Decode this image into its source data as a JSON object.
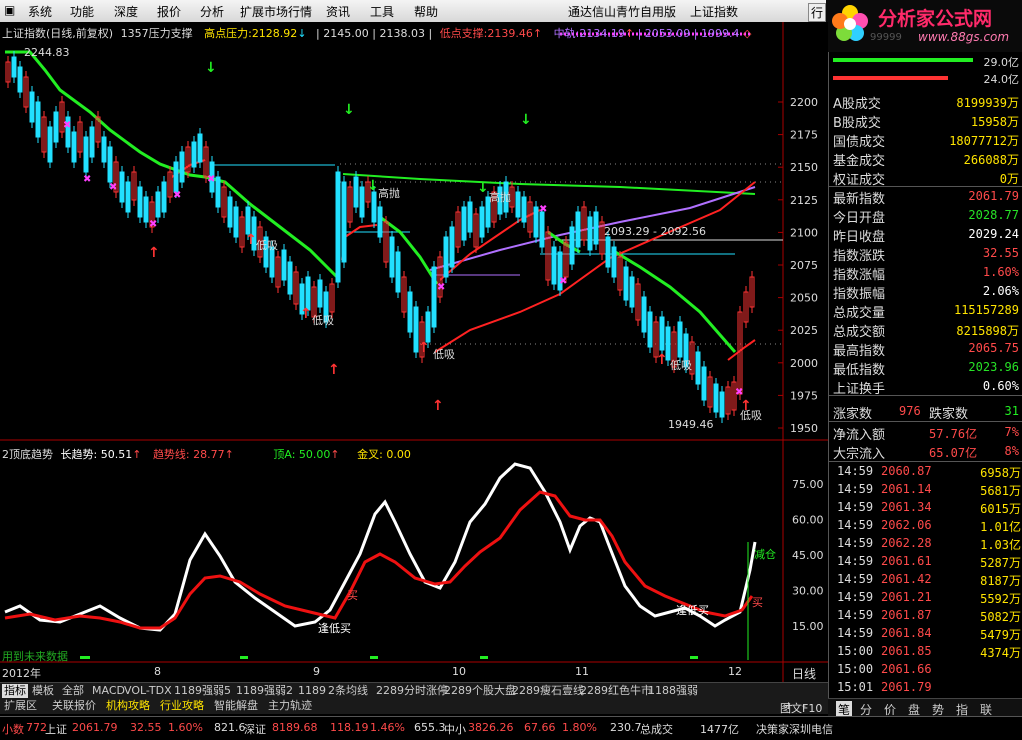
{
  "menu": {
    "items": [
      "系统",
      "功能",
      "深度",
      "报价",
      "分析",
      "扩展市场行情",
      "资讯",
      "工具",
      "帮助"
    ],
    "window_title": "通达信山青竹自用版",
    "index_title": "上证指数",
    "right_btn": "行"
  },
  "logo": {
    "brand": "分析家公式网",
    "url": "www.88gs.com",
    "sub_digits": "99999"
  },
  "main_header": {
    "name": "上证指数(日线,前复权)",
    "indicator": "1357压力支撑",
    "high_label": "高点压力:",
    "high_value": "2128.92",
    "v2": "2145.00",
    "v3": "2138.03",
    "low_label": "低点支撑:",
    "low_value": "2139.46",
    "mid_label": "中轨:",
    "mid_value": "2134.19",
    "v4": "2053.09",
    "v5": "1999.4"
  },
  "price_axis": [
    "2200",
    "2175",
    "2150",
    "2125",
    "2100",
    "2075",
    "2050",
    "2025",
    "2000",
    "1975",
    "1950"
  ],
  "annotations": {
    "top_price": "2244.83",
    "low_price": "1949.46",
    "range_label": "2093.29 - 2092.56",
    "high_throw": "高抛",
    "low_buy": "低吸",
    "sub_label": "低吸"
  },
  "sub_header": {
    "name": "2顶底趋势",
    "long_label": "长趋势:",
    "long_value": "50.51",
    "trend_label": "趋势线:",
    "trend_value": "28.77",
    "top_label": "顶A:",
    "top_value": "50.00",
    "gold_label": "金叉:",
    "gold_value": "0.00"
  },
  "sub_axis": [
    "75.00",
    "60.00",
    "45.00",
    "30.00",
    "15.00"
  ],
  "sub_annotations": {
    "buy_low": "逢低买",
    "reduce": "减仓",
    "buy": "买",
    "future": "用到未来数据"
  },
  "x_axis": {
    "labels": [
      "2012年",
      "8",
      "9",
      "10",
      "11",
      "12"
    ],
    "period": "日线"
  },
  "tabs_row1": [
    "指标",
    "模板",
    "全部",
    "MACD",
    "VOL-TDX",
    "1189强弱5",
    "1189强弱2",
    "1189",
    "2条均线",
    "2289分时涨停",
    "2289个股大盘",
    "2289瘦石壹线",
    "2289红色牛市",
    "1188强弱"
  ],
  "tabs_row1_active": "指标",
  "tabs_row2": [
    "扩展区",
    "关联报价",
    "机构攻略",
    "行业攻略",
    "智能解盘",
    "主力轨迹"
  ],
  "chart_buttons": {
    "plus": "+",
    "minus": "-",
    "page": "图文F10"
  },
  "side": {
    "bar1_value": "29.0亿",
    "bar2_value": "24.0亿",
    "rows": [
      {
        "label": "A股成交",
        "value": "8199939万",
        "color": "yellow"
      },
      {
        "label": "B股成交",
        "value": "15958万",
        "color": "yellow"
      },
      {
        "label": "国债成交",
        "value": "18077712万",
        "color": "yellow"
      },
      {
        "label": "基金成交",
        "value": "266088万",
        "color": "yellow"
      },
      {
        "label": "权证成交",
        "value": "0万",
        "color": "yellow"
      },
      {
        "label": "最新指数",
        "value": "2061.79",
        "color": "red"
      },
      {
        "label": "今日开盘",
        "value": "2028.77",
        "color": "green"
      },
      {
        "label": "昨日收盘",
        "value": "2029.24",
        "color": "white"
      },
      {
        "label": "指数涨跌",
        "value": "32.55",
        "color": "red"
      },
      {
        "label": "指数涨幅",
        "value": "1.60%",
        "color": "red"
      },
      {
        "label": "指数振幅",
        "value": "2.06%",
        "color": "white"
      },
      {
        "label": "总成交量",
        "value": "115157289",
        "color": "yellow"
      },
      {
        "label": "总成交额",
        "value": "8215898万",
        "color": "yellow"
      },
      {
        "label": "最高指数",
        "value": "2065.75",
        "color": "red"
      },
      {
        "label": "最低指数",
        "value": "2023.96",
        "color": "green"
      },
      {
        "label": "上证换手",
        "value": "0.60%",
        "color": "white"
      }
    ],
    "rise_label": "涨家数",
    "rise_value": "976",
    "fall_label": "跌家数",
    "fall_value": "31",
    "net_label": "净流入额",
    "net_value": "57.76亿",
    "net_pct": "7%",
    "big_label": "大宗流入",
    "big_value": "65.07亿",
    "big_pct": "8%",
    "ticks": [
      {
        "t": "14:59",
        "p": "2060.87",
        "v": "6958万"
      },
      {
        "t": "14:59",
        "p": "2061.14",
        "v": "5681万"
      },
      {
        "t": "14:59",
        "p": "2061.34",
        "v": "6015万"
      },
      {
        "t": "14:59",
        "p": "2062.06",
        "v": "1.01亿"
      },
      {
        "t": "14:59",
        "p": "2062.28",
        "v": "1.03亿"
      },
      {
        "t": "14:59",
        "p": "2061.61",
        "v": "5287万"
      },
      {
        "t": "14:59",
        "p": "2061.42",
        "v": "8187万"
      },
      {
        "t": "14:59",
        "p": "2061.21",
        "v": "5592万"
      },
      {
        "t": "14:59",
        "p": "2061.87",
        "v": "5082万"
      },
      {
        "t": "14:59",
        "p": "2061.84",
        "v": "5479万"
      },
      {
        "t": "15:00",
        "p": "2061.85",
        "v": "4374万"
      },
      {
        "t": "15:00",
        "p": "2061.66",
        "v": ""
      },
      {
        "t": "15:01",
        "p": "2061.79",
        "v": ""
      }
    ],
    "tabs": [
      "笔",
      "分",
      "价",
      "盘",
      "势",
      "指",
      "联"
    ]
  },
  "status": {
    "s1_label": "小数",
    "s1_val": "772",
    "s2_label": "上证",
    "s2_val": "2061.79",
    "s2_chg": "32.55",
    "s2_pct": "1.60%",
    "s2_amt": "821.6",
    "s3_label": "深证",
    "s3_val": "8189.68",
    "s3_chg": "118.19",
    "s3_pct": "1.46%",
    "s3_amt": "655.3",
    "s4_label": "中小",
    "s4_val": "3826.26",
    "s4_chg": "67.66",
    "s4_pct": "1.80%",
    "s4_amt": "230.7",
    "s5_label": "总成交",
    "s5_val": "1477亿",
    "s6": "决策家深圳电信"
  },
  "colors": {
    "up": "#ff3333",
    "down": "#22e0ff",
    "ma_green": "#22ee22",
    "ma_red": "#ff2222",
    "ma_purple": "#b070ff",
    "white_line": "#ffffff"
  }
}
